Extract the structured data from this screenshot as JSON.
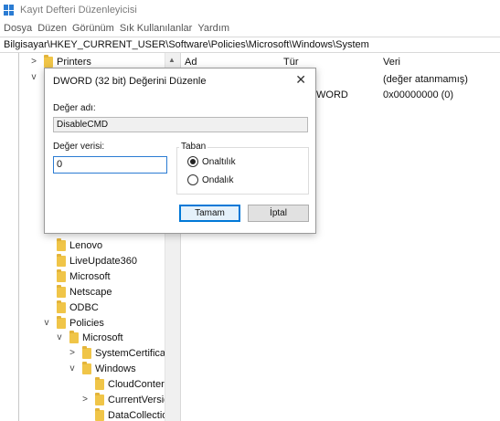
{
  "window": {
    "title": "Kayıt Defteri Düzenleyicisi",
    "icon": "registry-icon"
  },
  "menu": [
    "Dosya",
    "Düzen",
    "Görünüm",
    "Sık Kullanılanlar",
    "Yardım"
  ],
  "address": "Bilgisayar\\HKEY_CURRENT_USER\\Software\\Policies\\Microsoft\\Windows\\System",
  "tree": [
    {
      "label": "Printers",
      "expander": ">"
    },
    {
      "label": "",
      "expander": "v"
    },
    {
      "label": "Lenovo",
      "expander": ""
    },
    {
      "label": "LiveUpdate360",
      "expander": ""
    },
    {
      "label": "Microsoft",
      "expander": ""
    },
    {
      "label": "Netscape",
      "expander": ""
    },
    {
      "label": "ODBC",
      "expander": ""
    },
    {
      "label": "Policies",
      "expander": "v"
    },
    {
      "label": "Microsoft",
      "expander": "v"
    },
    {
      "label": "SystemCertificat",
      "expander": ">"
    },
    {
      "label": "Windows",
      "expander": "v"
    },
    {
      "label": "CloudConter",
      "expander": ""
    },
    {
      "label": "CurrentVersio",
      "expander": ">"
    },
    {
      "label": "DataCollectio",
      "expander": ""
    }
  ],
  "values_table": {
    "columns": [
      "Ad",
      "Tür",
      "Veri"
    ],
    "rows": [
      {
        "type": "",
        "data": "(değer atanmamış)"
      },
      {
        "type": "WORD",
        "data": "0x00000000 (0)"
      }
    ]
  },
  "dialog": {
    "title": "DWORD (32 bit) Değerini Düzenle",
    "close": "✕",
    "name_label": "Değer adı:",
    "name_value": "DisableCMD",
    "data_label": "Değer verisi:",
    "data_value": "0",
    "base_label": "Taban",
    "radio_hex": "Onaltılık",
    "radio_dec": "Ondalık",
    "base_selected": "hex",
    "ok": "Tamam",
    "cancel": "İptal"
  },
  "colors": {
    "accent": "#0078d7",
    "folder": "#f0c548"
  }
}
